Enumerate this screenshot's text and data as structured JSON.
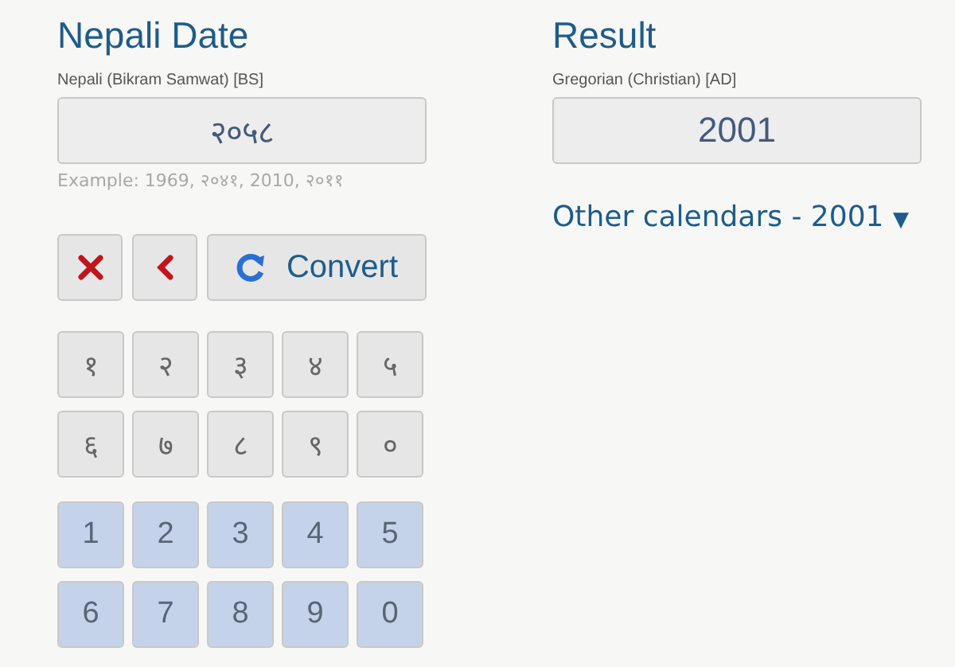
{
  "input_panel": {
    "title": "Nepali Date",
    "field_label": "Nepali (Bikram Samwat) [BS]",
    "value": "२०५८",
    "example": "Example: 1969, २०४१, 2010, २०११"
  },
  "actions": [
    {
      "kind": "clear"
    },
    {
      "kind": "backspace"
    },
    {
      "kind": "convert",
      "label": "Convert"
    }
  ],
  "nepali_keys": [
    "१",
    "२",
    "३",
    "४",
    "५",
    "६",
    "७",
    "८",
    "९",
    "०"
  ],
  "latin_keys": [
    "1",
    "2",
    "3",
    "4",
    "5",
    "6",
    "7",
    "8",
    "9",
    "0"
  ],
  "result_panel": {
    "title": "Result",
    "field_label": "Gregorian (Christian) [AD]",
    "value": "2001",
    "other_link": "Other calendars - 2001",
    "link_caret": "▼"
  }
}
